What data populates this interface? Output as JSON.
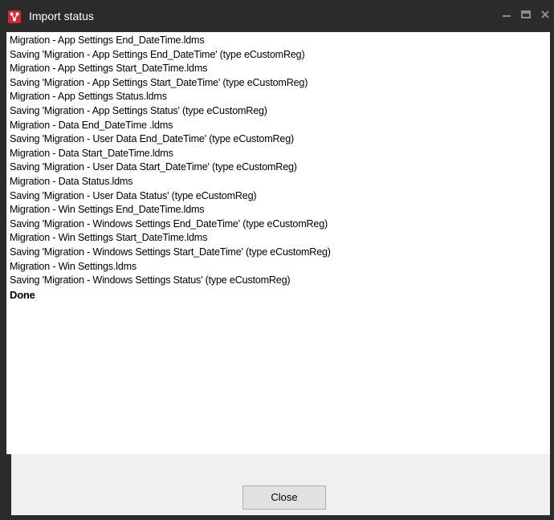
{
  "window": {
    "title": "Import status",
    "controls": {
      "minimize_icon": "minimize-icon",
      "maximize_icon": "maximize-icon",
      "close_icon": "close-icon"
    }
  },
  "log": {
    "lines": [
      "Migration - App Settings End_DateTime.ldms",
      "Saving 'Migration - App Settings End_DateTime' (type eCustomReg)",
      "Migration - App Settings Start_DateTime.ldms",
      "Saving 'Migration - App Settings Start_DateTime' (type eCustomReg)",
      "Migration - App Settings Status.ldms",
      "Saving 'Migration - App Settings Status' (type eCustomReg)",
      "Migration - Data End_DateTime .ldms",
      "Saving 'Migration - User Data End_DateTime' (type eCustomReg)",
      "Migration - Data Start_DateTime.ldms",
      "Saving 'Migration - User Data Start_DateTime' (type eCustomReg)",
      "Migration - Data Status.ldms",
      "Saving 'Migration - User Data Status' (type eCustomReg)",
      "Migration - Win Settings End_DateTime.ldms",
      "Saving 'Migration - Windows Settings End_DateTime' (type eCustomReg)",
      "Migration - Win Settings Start_DateTime.ldms",
      "Saving 'Migration - Windows Settings Start_DateTime' (type eCustomReg)",
      "Migration - Win Settings.ldms",
      "Saving 'Migration - Windows Settings Status' (type eCustomReg)"
    ],
    "done": "Done"
  },
  "footer": {
    "close_label": "Close"
  },
  "colors": {
    "titlebar": "#2b2b2b",
    "app_icon": "#d9262e",
    "panel": "#f0f0f0"
  }
}
